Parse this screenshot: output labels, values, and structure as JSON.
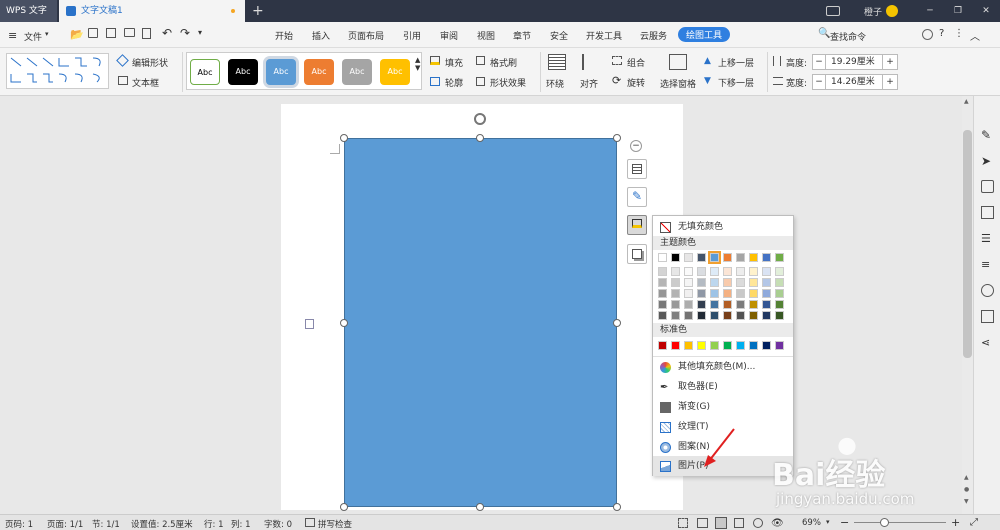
{
  "titlebar": {
    "app_tab": "WPS 文字",
    "doc_tab": "文字文稿1",
    "new_tab": "+",
    "user": "橙子"
  },
  "menu_tabs": [
    "开始",
    "插入",
    "页面布局",
    "引用",
    "审阅",
    "视图",
    "章节",
    "安全",
    "开发工具",
    "云服务",
    "绘图工具"
  ],
  "menubar": {
    "file": "文件",
    "search": "查找命令"
  },
  "ribbon": {
    "edit_shape": "编辑形状",
    "text_box": "文本框",
    "styles": [
      "Abc",
      "Abc",
      "Abc",
      "Abc",
      "Abc",
      "Abc"
    ],
    "fill": "填充",
    "outline": "轮廓",
    "format_brush": "格式刷",
    "shape_effect": "形状效果",
    "wrap": "环绕",
    "align": "对齐",
    "group": "组合",
    "rotate": "旋转",
    "select_pane": "选择窗格",
    "bring_forward": "上移一层",
    "send_backward": "下移一层",
    "height_label": "高度:",
    "height_value": "19.29厘米",
    "width_label": "宽度:",
    "width_value": "14.26厘米",
    "minus": "−",
    "plus": "+"
  },
  "colors": {
    "accent": "#2a72c9",
    "shape_fill": "#5b9bd5",
    "tab_active": "#2f7fe0"
  },
  "fill_menu": {
    "no_fill": "无填充颜色",
    "theme_colors": "主题颜色",
    "standard_colors": "标准色",
    "more_colors": "其他填充颜色(M)...",
    "eyedropper": "取色器(E)",
    "gradient": "渐变(G)",
    "texture": "纹理(T)",
    "pattern": "图案(N)",
    "picture": "图片(P)"
  },
  "status": {
    "page_num": "页码: 1",
    "pages": "页面: 1/1",
    "section": "节: 1/1",
    "setting": "设置值: 2.5厘米",
    "row": "行: 1",
    "col": "列: 1",
    "words": "字数: 0",
    "spell": "拼写检查",
    "zoom": "69%"
  },
  "watermark": {
    "brand": "Bai经验",
    "url": "jingyan.baidu.com"
  }
}
